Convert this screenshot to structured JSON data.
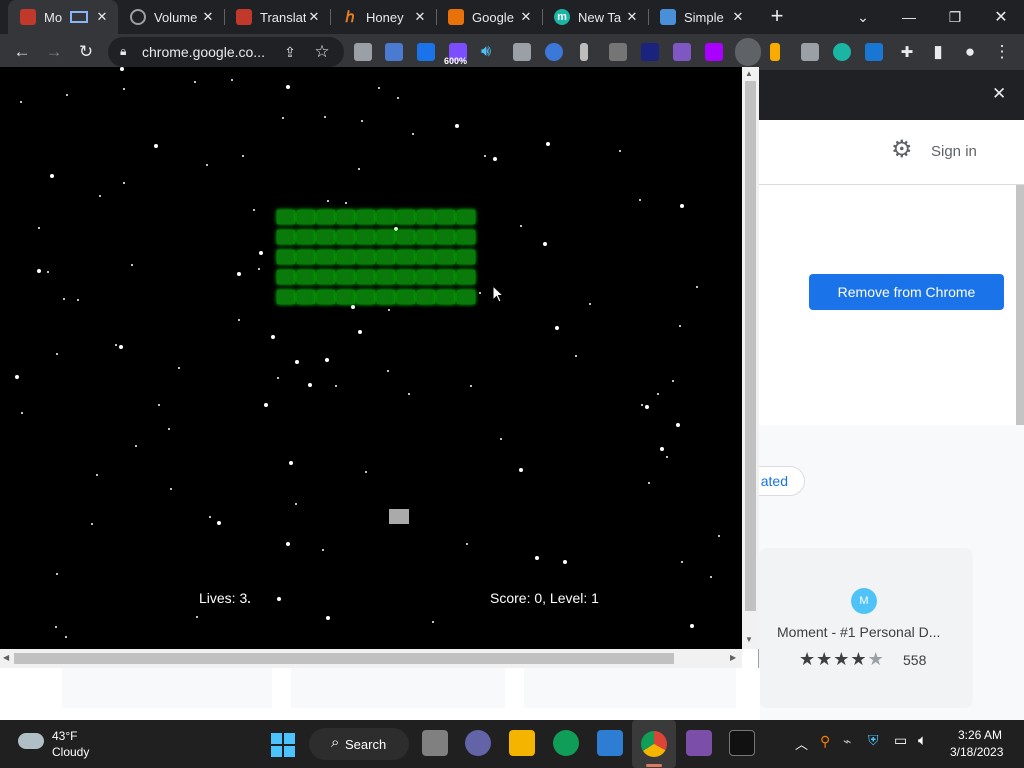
{
  "tabs": [
    {
      "label": "Mo",
      "icon": "moment-icon",
      "color": "#c0392b"
    },
    {
      "label": "Volume",
      "icon": "volume-icon",
      "color": "#5f6368"
    },
    {
      "label": "Translat",
      "icon": "translate-icon",
      "color": "#c0392b"
    },
    {
      "label": "Honey",
      "icon": "honey-icon",
      "color": "#e67e22"
    },
    {
      "label": "Google",
      "icon": "google-icon",
      "color": "#e8710a"
    },
    {
      "label": "New Ta",
      "icon": "moment-icon",
      "color": "#1bb5a4"
    },
    {
      "label": "Simple",
      "icon": "simple-icon",
      "color": "#4a90d9"
    }
  ],
  "toolbar": {
    "url": "chrome.google.co...",
    "ext_badge": "600%"
  },
  "store": {
    "signin": "Sign in",
    "remove_button": "Remove from Chrome",
    "chip_label": "ated",
    "card_title": "Moment - #1 Personal D...",
    "card_rating": 4,
    "card_reviews": "558"
  },
  "game": {
    "lives": "Lives: 3",
    "score": "Score: 0, Level: 1",
    "brick_color": "#0a7a0a"
  },
  "taskbar": {
    "temp": "43°F",
    "weather": "Cloudy",
    "search": "Search",
    "time": "3:26 AM",
    "date": "3/18/2023"
  }
}
